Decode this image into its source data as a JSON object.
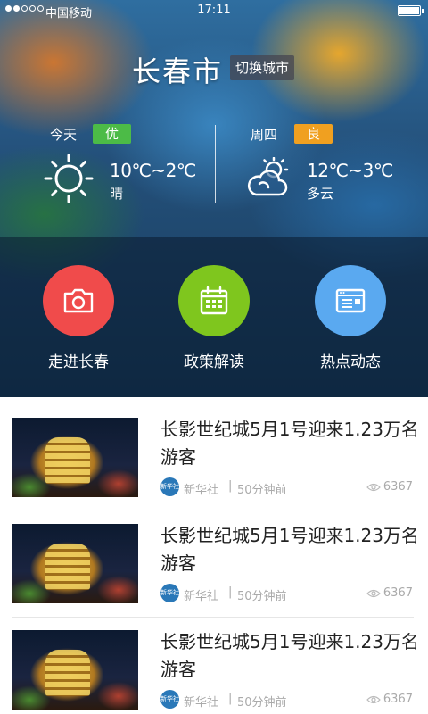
{
  "status_bar": {
    "carrier": "中国移动",
    "time": "17:11"
  },
  "header": {
    "city": "长春市",
    "switch_city_label": "切换城市"
  },
  "weather": {
    "today": {
      "day_label": "今天",
      "aqi": "优",
      "aqi_color": "#4cbb47",
      "temp": "10℃~2℃",
      "condition": "晴",
      "icon": "sun-icon"
    },
    "tomorrow": {
      "day_label": "周四",
      "aqi": "良",
      "aqi_color": "#f0a020",
      "temp": "12℃~3℃",
      "condition": "多云",
      "icon": "partly-cloudy-icon"
    }
  },
  "quick_links": [
    {
      "label": "走进长春",
      "icon": "camera-icon",
      "color": "#f04b4b"
    },
    {
      "label": "政策解读",
      "icon": "calendar-icon",
      "color": "#7fc61e"
    },
    {
      "label": "热点动态",
      "icon": "browser-window-icon",
      "color": "#5aa9f0"
    }
  ],
  "news": [
    {
      "title": "长影世纪城5月1号迎来1.23万名游客",
      "source": "新华社",
      "time": "50分钟前",
      "views": "6367"
    },
    {
      "title": "长影世纪城5月1号迎来1.23万名游客",
      "source": "新华社",
      "time": "50分钟前",
      "views": "6367"
    },
    {
      "title": "长影世纪城5月1号迎来1.23万名游客",
      "source": "新华社",
      "time": "50分钟前",
      "views": "6367"
    }
  ],
  "separator": "|",
  "source_logo_text": "新华社"
}
